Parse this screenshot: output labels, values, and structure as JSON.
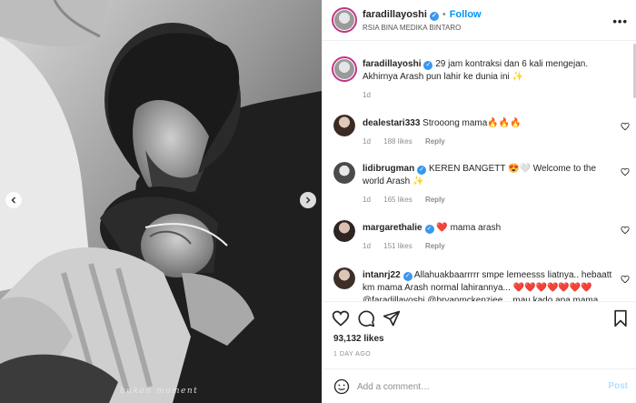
{
  "post": {
    "photo_caption_watermark": "bukan moment",
    "icons": {
      "prev": "chevron-left-icon",
      "next": "chevron-right-icon"
    }
  },
  "header": {
    "username": "faradillayoshi",
    "verified_glyph": "✓",
    "separator": "•",
    "follow_label": "Follow",
    "location": "RSIA BINA MEDIKA BINTARO",
    "more_label": "•••"
  },
  "caption": {
    "username": "faradillayoshi",
    "text": "29 jam kontraksi dan 6 kali mengejan. Akhirnya Arash pun lahir ke dunia ini ✨",
    "time": "1d"
  },
  "comments": [
    {
      "username": "dealestari333",
      "verified": false,
      "text": "Strooong mama🔥🔥🔥",
      "time": "1d",
      "likes": "188 likes",
      "reply": "Reply"
    },
    {
      "username": "lidibrugman",
      "verified": true,
      "text": "KEREN BANGETT 😍🤍 Welcome to the world Arash ✨",
      "time": "1d",
      "likes": "165 likes",
      "reply": "Reply"
    },
    {
      "username": "margarethalie",
      "verified": true,
      "text": "❤️ mama arash",
      "time": "1d",
      "likes": "151 likes",
      "reply": "Reply"
    },
    {
      "username": "intanrj22",
      "verified": true,
      "text": "Allahuakbaarrrrr smpe lemeesss liatnya.. hebaatt km mama Arash normal lahirannya... ❤️❤️❤️❤️❤️❤️❤️ @faradillayoshi @bryanmckenziee .. mau kado apa mama",
      "time": "",
      "likes": "",
      "reply": ""
    }
  ],
  "footer": {
    "likes_count": "93,132 likes",
    "date": "1 DAY AGO",
    "comment_placeholder": "Add a comment…",
    "post_label": "Post"
  },
  "colors": {
    "accent": "#0095f6",
    "verified": "#3897f0",
    "heart": "#ed4956",
    "muted": "#8e8e8e"
  }
}
